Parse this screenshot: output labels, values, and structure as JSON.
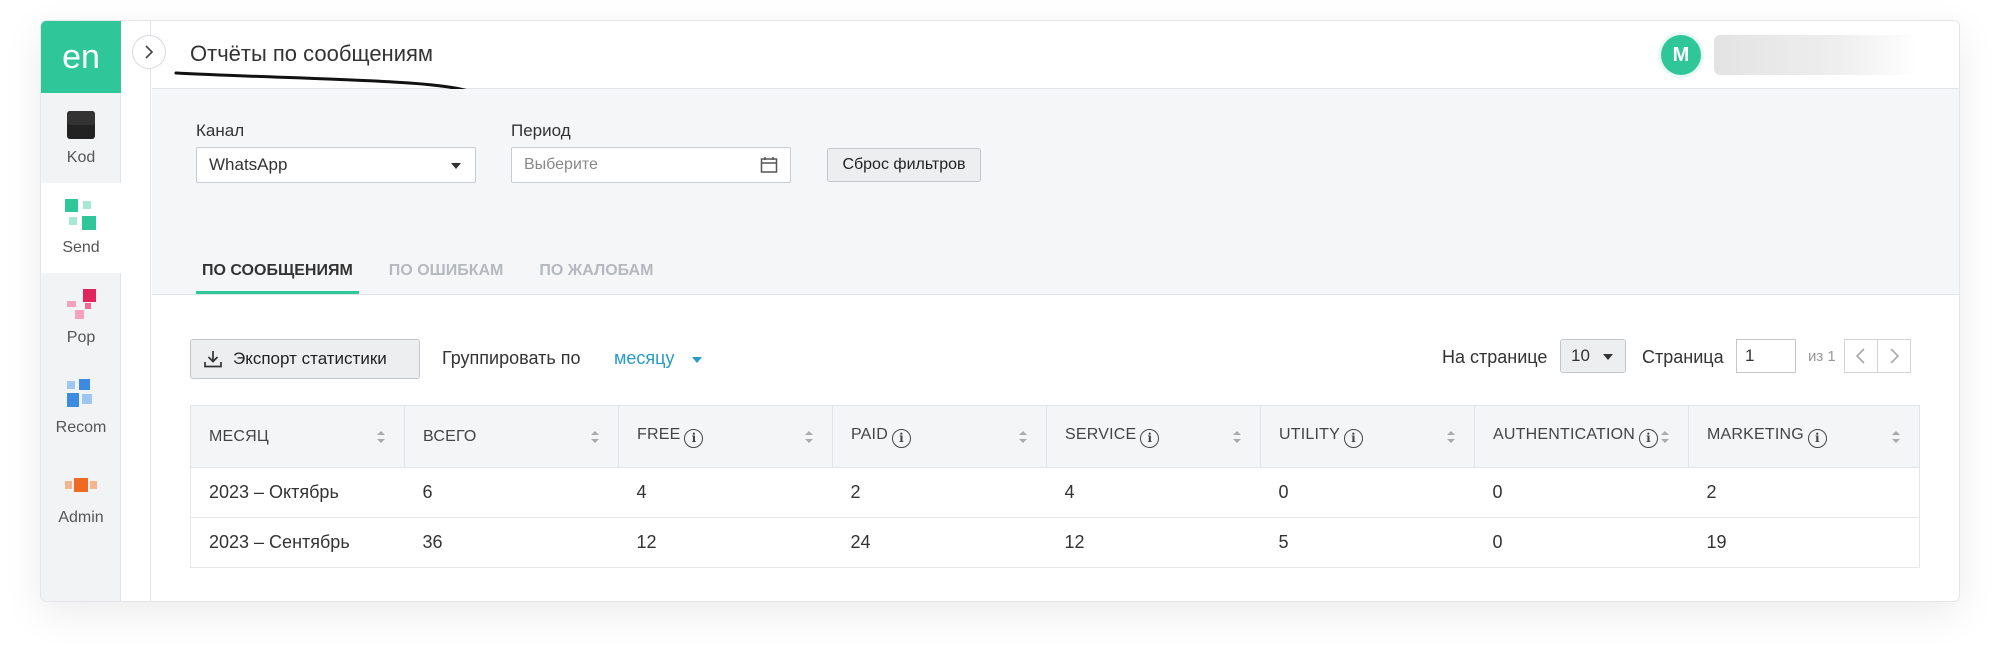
{
  "sidebar": {
    "logo": "en",
    "items": [
      {
        "label": "Kod",
        "icon": "kod-icon"
      },
      {
        "label": "Send",
        "icon": "send-icon"
      },
      {
        "label": "Pop",
        "icon": "pop-icon"
      },
      {
        "label": "Recom",
        "icon": "recom-icon"
      },
      {
        "label": "Admin",
        "icon": "admin-icon"
      }
    ],
    "active_index": 1
  },
  "header": {
    "title": "Отчёты по сообщениям",
    "avatar_letter": "M"
  },
  "filters": {
    "channel_label": "Канал",
    "channel_value": "WhatsApp",
    "period_label": "Период",
    "period_placeholder": "Выберите",
    "reset_label": "Сброс фильтров"
  },
  "tabs": [
    {
      "label": "ПО СООБЩЕНИЯМ",
      "active": true
    },
    {
      "label": "ПО ОШИБКАМ",
      "active": false
    },
    {
      "label": "ПО ЖАЛОБАМ",
      "active": false
    }
  ],
  "toolbar": {
    "export_label": "Экспорт статистики",
    "group_label": "Группировать по",
    "group_value": "месяцу",
    "per_page_label": "На странице",
    "per_page_value": "10",
    "page_label": "Страница",
    "page_value": "1",
    "page_of": "из 1"
  },
  "table": {
    "columns": [
      "МЕСЯЦ",
      "ВСЕГО",
      "FREE",
      "PAID",
      "SERVICE",
      "UTILITY",
      "AUTHENTICATION",
      "MARKETING"
    ],
    "rows": [
      [
        "2023 – Октябрь",
        "6",
        "4",
        "2",
        "4",
        "0",
        "0",
        "2"
      ],
      [
        "2023 – Сентябрь",
        "36",
        "12",
        "24",
        "12",
        "5",
        "0",
        "19"
      ]
    ]
  },
  "colors": {
    "accent": "#2fc79a",
    "link": "#2a9bc7"
  }
}
